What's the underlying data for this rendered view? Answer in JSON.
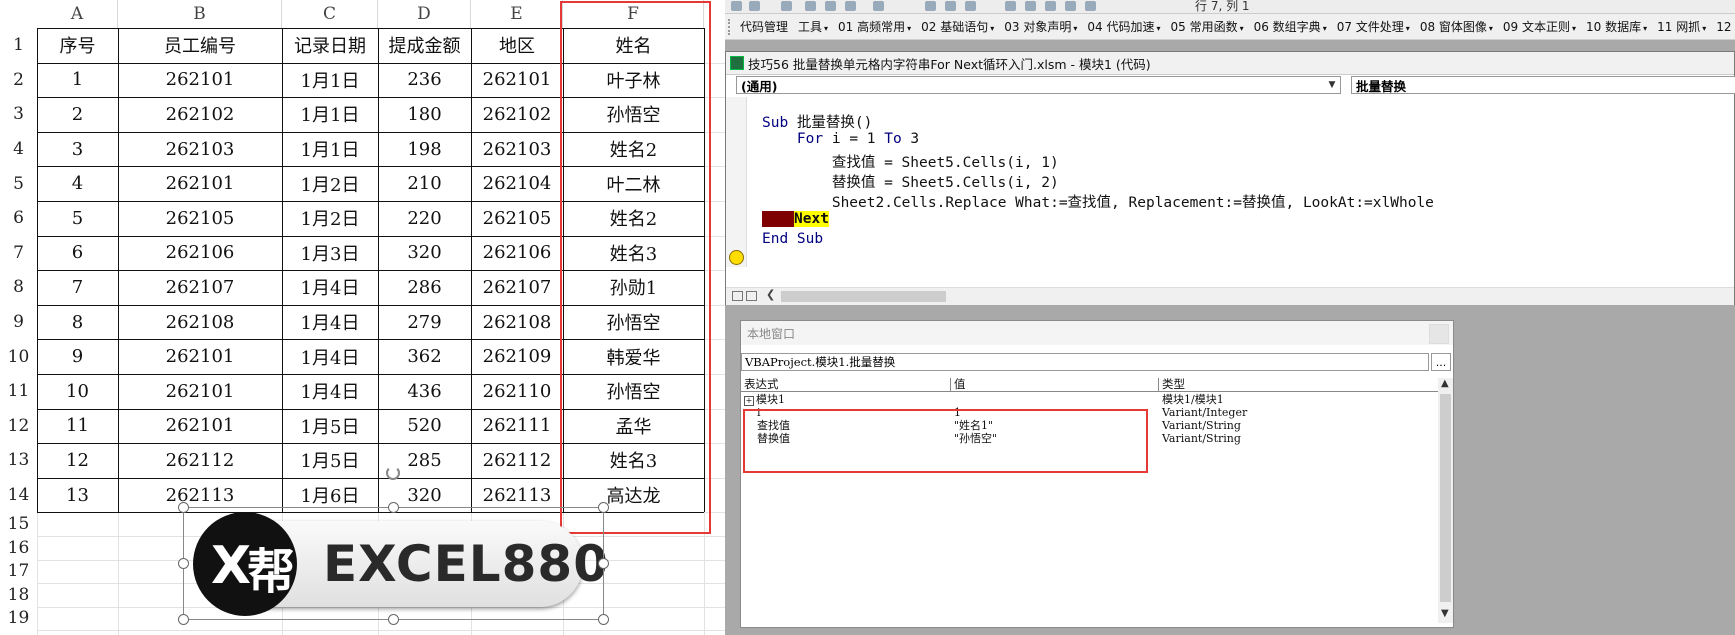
{
  "sheet": {
    "columns": [
      "A",
      "B",
      "C",
      "D",
      "E",
      "F"
    ],
    "row_numbers": [
      "1",
      "2",
      "3",
      "4",
      "5",
      "6",
      "7",
      "8",
      "9",
      "10",
      "11",
      "12",
      "13",
      "14",
      "15",
      "16",
      "17",
      "18",
      "19"
    ],
    "table": {
      "headers": [
        "序号",
        "员工编号",
        "记录日期",
        "提成金额",
        "地区",
        "姓名"
      ],
      "rows": [
        [
          "1",
          "262101",
          "1月1日",
          "236",
          "262101",
          "叶子林"
        ],
        [
          "2",
          "262102",
          "1月1日",
          "180",
          "262102",
          "孙悟空"
        ],
        [
          "3",
          "262103",
          "1月1日",
          "198",
          "262103",
          "姓名2"
        ],
        [
          "4",
          "262101",
          "1月2日",
          "210",
          "262104",
          "叶二林"
        ],
        [
          "5",
          "262105",
          "1月2日",
          "220",
          "262105",
          "姓名2"
        ],
        [
          "6",
          "262106",
          "1月3日",
          "320",
          "262106",
          "姓名3"
        ],
        [
          "7",
          "262107",
          "1月4日",
          "286",
          "262107",
          "孙勋1"
        ],
        [
          "8",
          "262108",
          "1月4日",
          "279",
          "262108",
          "孙悟空"
        ],
        [
          "9",
          "262101",
          "1月4日",
          "362",
          "262109",
          "韩爱华"
        ],
        [
          "10",
          "262101",
          "1月4日",
          "436",
          "262110",
          "孙悟空"
        ],
        [
          "11",
          "262101",
          "1月5日",
          "520",
          "262111",
          "孟华"
        ],
        [
          "12",
          "262112",
          "1月5日",
          "285",
          "262112",
          "姓名3"
        ],
        [
          "13",
          "262113",
          "1月6日",
          "320",
          "262113",
          "高达龙"
        ]
      ]
    },
    "logo": {
      "circle_letter": "X",
      "circle_char": "帮",
      "brand": "EXCEL880"
    }
  },
  "vbe": {
    "partial_toolbar_text": "行 7, 列 1",
    "menu": [
      {
        "label": "代码管理",
        "dropdown": false
      },
      {
        "label": "工具",
        "dropdown": true
      },
      {
        "label": "01 高频常用",
        "dropdown": true
      },
      {
        "label": "02 基础语句",
        "dropdown": true
      },
      {
        "label": "03 对象声明",
        "dropdown": true
      },
      {
        "label": "04 代码加速",
        "dropdown": true
      },
      {
        "label": "05 常用函数",
        "dropdown": true
      },
      {
        "label": "06 数组字典",
        "dropdown": true
      },
      {
        "label": "07 文件处理",
        "dropdown": true
      },
      {
        "label": "08 窗体图像",
        "dropdown": true
      },
      {
        "label": "09 文本正则",
        "dropdown": true
      },
      {
        "label": "10 数据库",
        "dropdown": true
      },
      {
        "label": "11 网抓",
        "dropdown": true
      },
      {
        "label": "12",
        "dropdown": false
      }
    ],
    "code_window": {
      "title": "技巧56 批量替换单元格内字符串For Next循环入门.xlsm - 模块1 (代码)",
      "object_combo": "(通用)",
      "proc_combo": "批量替换",
      "lines": [
        {
          "kw": "Sub",
          "text": " 批量替换()"
        },
        {
          "indent": "    ",
          "kw": "For",
          "text": " i = 1 ",
          "kw2": "To",
          "text2": " 3"
        },
        {
          "indent": "        ",
          "text": "查找值 = Sheet5.Cells(i, 1)"
        },
        {
          "indent": "        ",
          "text": "替换值 = Sheet5.Cells(i, 2)"
        },
        {
          "indent": "        ",
          "text": "Sheet2.Cells.Replace What:=查找值, Replacement:=替换值, LookAt:=xlWhole"
        },
        {
          "highlight": "Next"
        },
        {
          "kw": "End Sub",
          "text": ""
        }
      ]
    },
    "locals": {
      "title": "本地窗口",
      "context": "VBAProject.模块1.批量替换",
      "more": "...",
      "headers": [
        "表达式",
        "值",
        "类型"
      ],
      "rows": [
        {
          "expr": "模块1",
          "value": "",
          "type": "模块1/模块1",
          "expander": "+"
        },
        {
          "expr": "i",
          "value": "1",
          "type": "Variant/Integer"
        },
        {
          "expr": "查找值",
          "value": "\"姓名1\"",
          "type": "Variant/String"
        },
        {
          "expr": "替换值",
          "value": "\"孙悟空\"",
          "type": "Variant/String"
        }
      ]
    }
  }
}
